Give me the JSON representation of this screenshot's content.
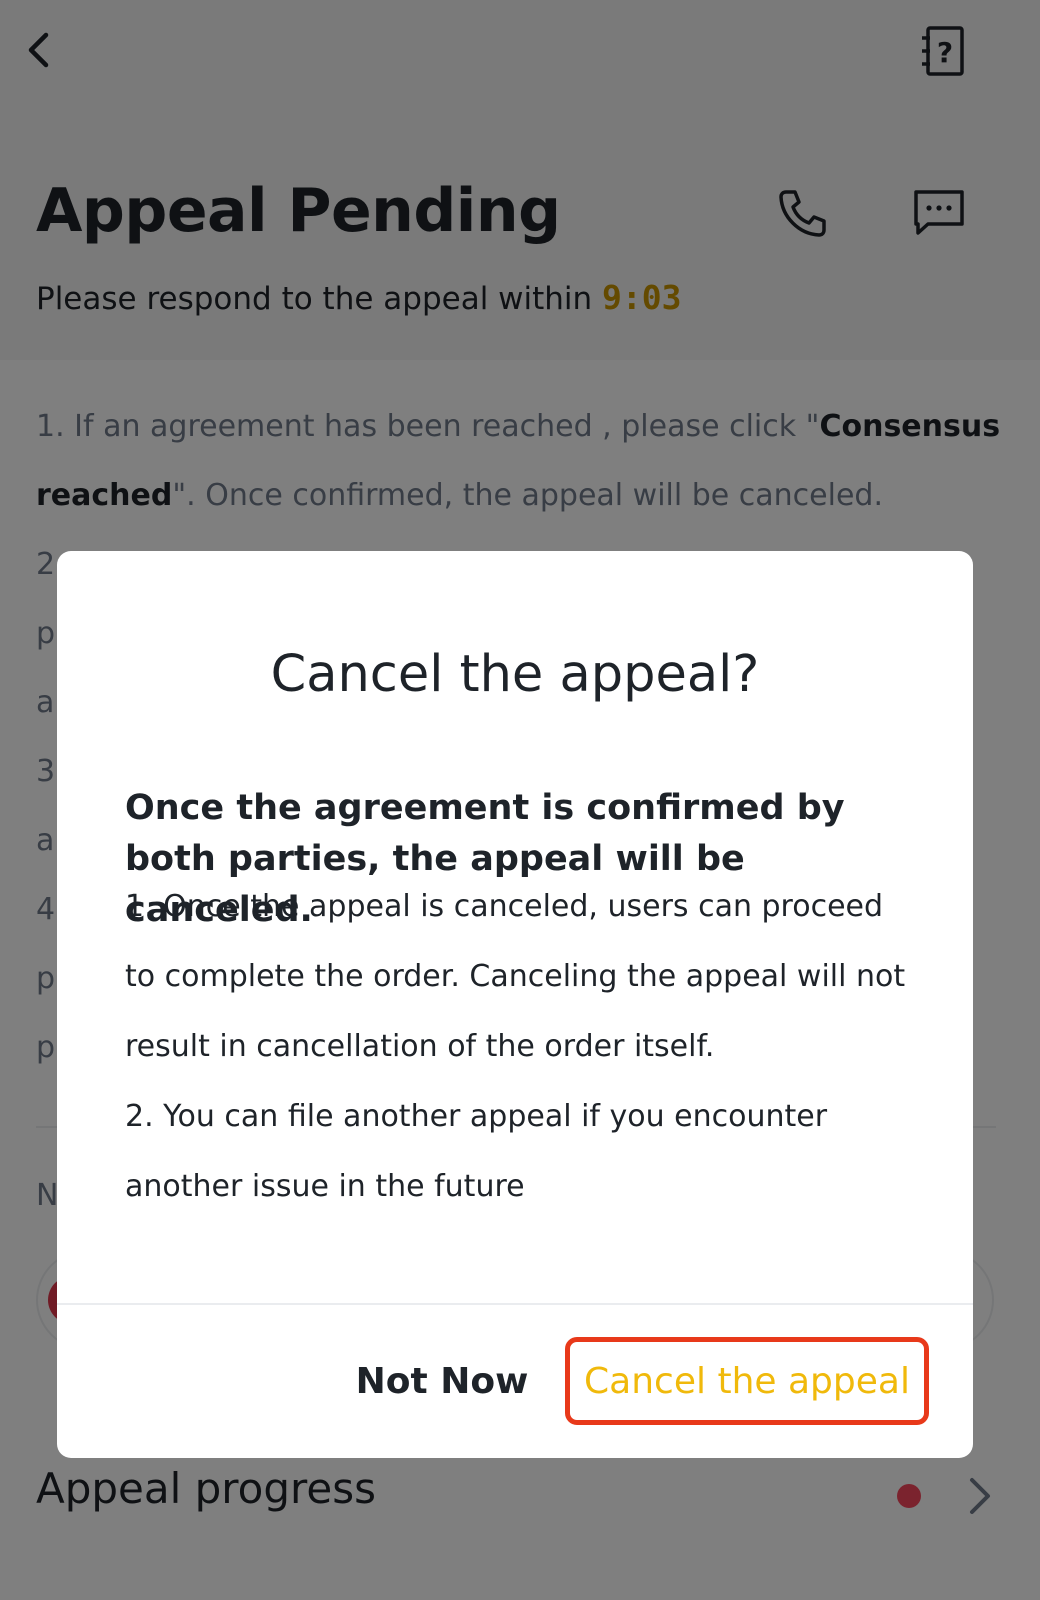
{
  "header": {
    "title": "Appeal Pending",
    "subtitle_prefix": "Please respond to the appeal within ",
    "countdown": "9:03"
  },
  "instructions": {
    "line1_text": "1. If an agreement has been reached , please click \"",
    "line1_bold": "Consensus",
    "line2_bold": "reached",
    "line2_text": "\". Once confirmed, the appeal will be canceled.",
    "partial_left": [
      "2",
      "pl",
      "ar",
      "3",
      "ar",
      "4",
      "pr",
      "pr"
    ],
    "negotiation_label": "N"
  },
  "progress": {
    "label": "Appeal progress"
  },
  "modal": {
    "title": "Cancel the appeal?",
    "lead": "Once the agreement is confirmed by both parties, the appeal will be canceled.",
    "lines": [
      "1. Once the appeal is canceled, users can proceed",
      "to complete the order. Canceling the appeal will not",
      "result in cancellation of the order itself.",
      "2. You can file another appeal if you encounter",
      "another issue in the future"
    ],
    "not_now_label": "Not Now",
    "cancel_label": "Cancel the appeal"
  },
  "colors": {
    "accent": "#f0b90b",
    "countdown": "#c99400",
    "highlight_border": "#e8391a",
    "notification_dot": "#f6465d"
  },
  "icons": {
    "back": "chevron-left-icon",
    "help": "help-book-icon",
    "phone": "phone-icon",
    "chat": "chat-bubble-icon",
    "forward": "chevron-right-icon"
  }
}
